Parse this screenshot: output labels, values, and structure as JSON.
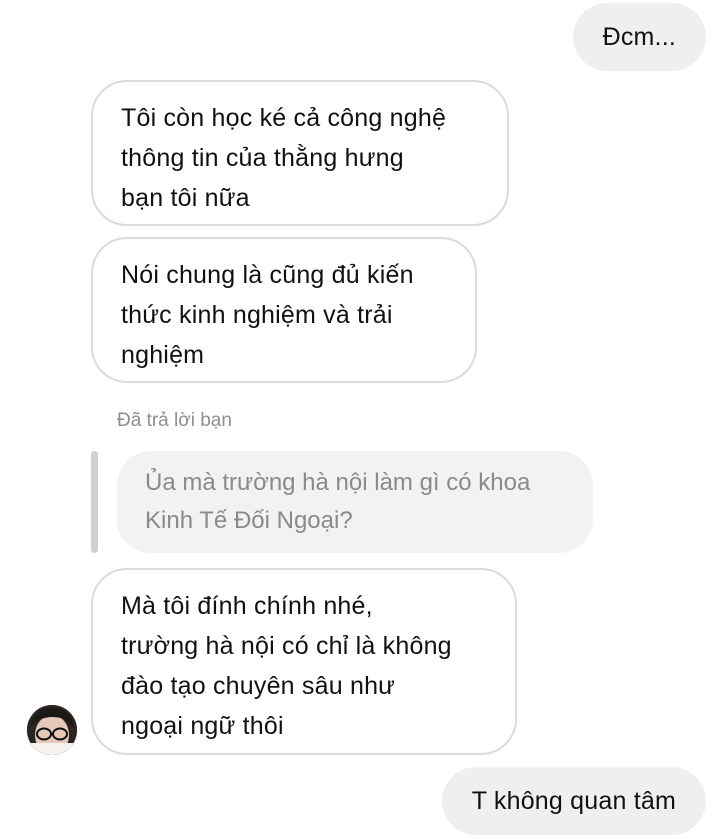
{
  "messages": {
    "sent_1": "Đcm...",
    "received_1": [
      "Tôi còn học ké cả công nghệ",
      "thông tin của thằng hưng",
      "bạn tôi nữa"
    ],
    "received_2": [
      "Nói chung là cũng đủ kiến",
      "thức kinh nghiệm và trải",
      "nghiệm"
    ],
    "reply_caption": "Đã trả lời bạn",
    "quoted": [
      "Ủa mà trường hà nội làm gì có khoa",
      "Kinh Tế Đối Ngoại?"
    ],
    "received_3": [
      "Mà tôi đính chính nhé,",
      "trường hà nội có chỉ là không",
      "đào tạo chuyên sâu như",
      "ngoại ngữ thôi"
    ],
    "sent_2": "T không quan tâm"
  },
  "colors": {
    "sent_bubble": "#efefef",
    "received_border": "#dbdbdb",
    "quoted_bg": "#f2f2f2",
    "muted_text": "#8e8e8e"
  },
  "icons": {
    "avatar": "profile-photo"
  }
}
